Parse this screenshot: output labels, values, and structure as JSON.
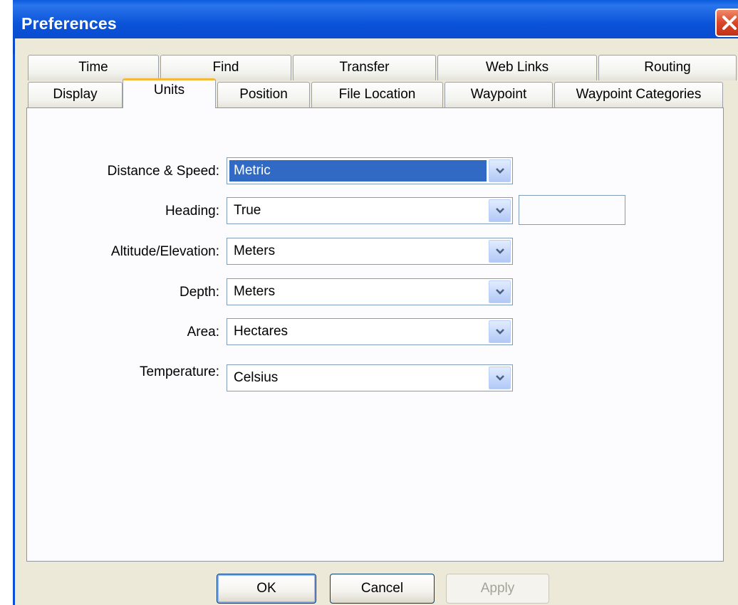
{
  "window": {
    "title": "Preferences"
  },
  "tabs": {
    "row_back": [
      "Time",
      "Find",
      "Transfer",
      "Web Links",
      "Routing"
    ],
    "row_front": [
      "Display",
      "Units",
      "Position",
      "File Location",
      "Waypoint",
      "Waypoint Categories"
    ],
    "active": "Units"
  },
  "units": {
    "distance_label": "Distance & Speed:",
    "distance_value": "Metric",
    "heading_label": "Heading:",
    "heading_value": "True",
    "heading_extra_value": "",
    "altitude_label": "Altitude/Elevation:",
    "altitude_value": "Meters",
    "depth_label": "Depth:",
    "depth_value": "Meters",
    "area_label": "Area:",
    "area_value": "Hectares",
    "temperature_label": "Temperature:",
    "temperature_value": "Celsius"
  },
  "buttons": {
    "ok": "OK",
    "cancel": "Cancel",
    "apply": "Apply"
  },
  "icons": {
    "close": "close-icon",
    "dropdown": "chevron-down-icon"
  },
  "colors": {
    "titlebar": "#0a52d8",
    "selection": "#316ac5",
    "active_tab_accent": "#f4b83a",
    "dialog_bg": "#ece9d8"
  }
}
